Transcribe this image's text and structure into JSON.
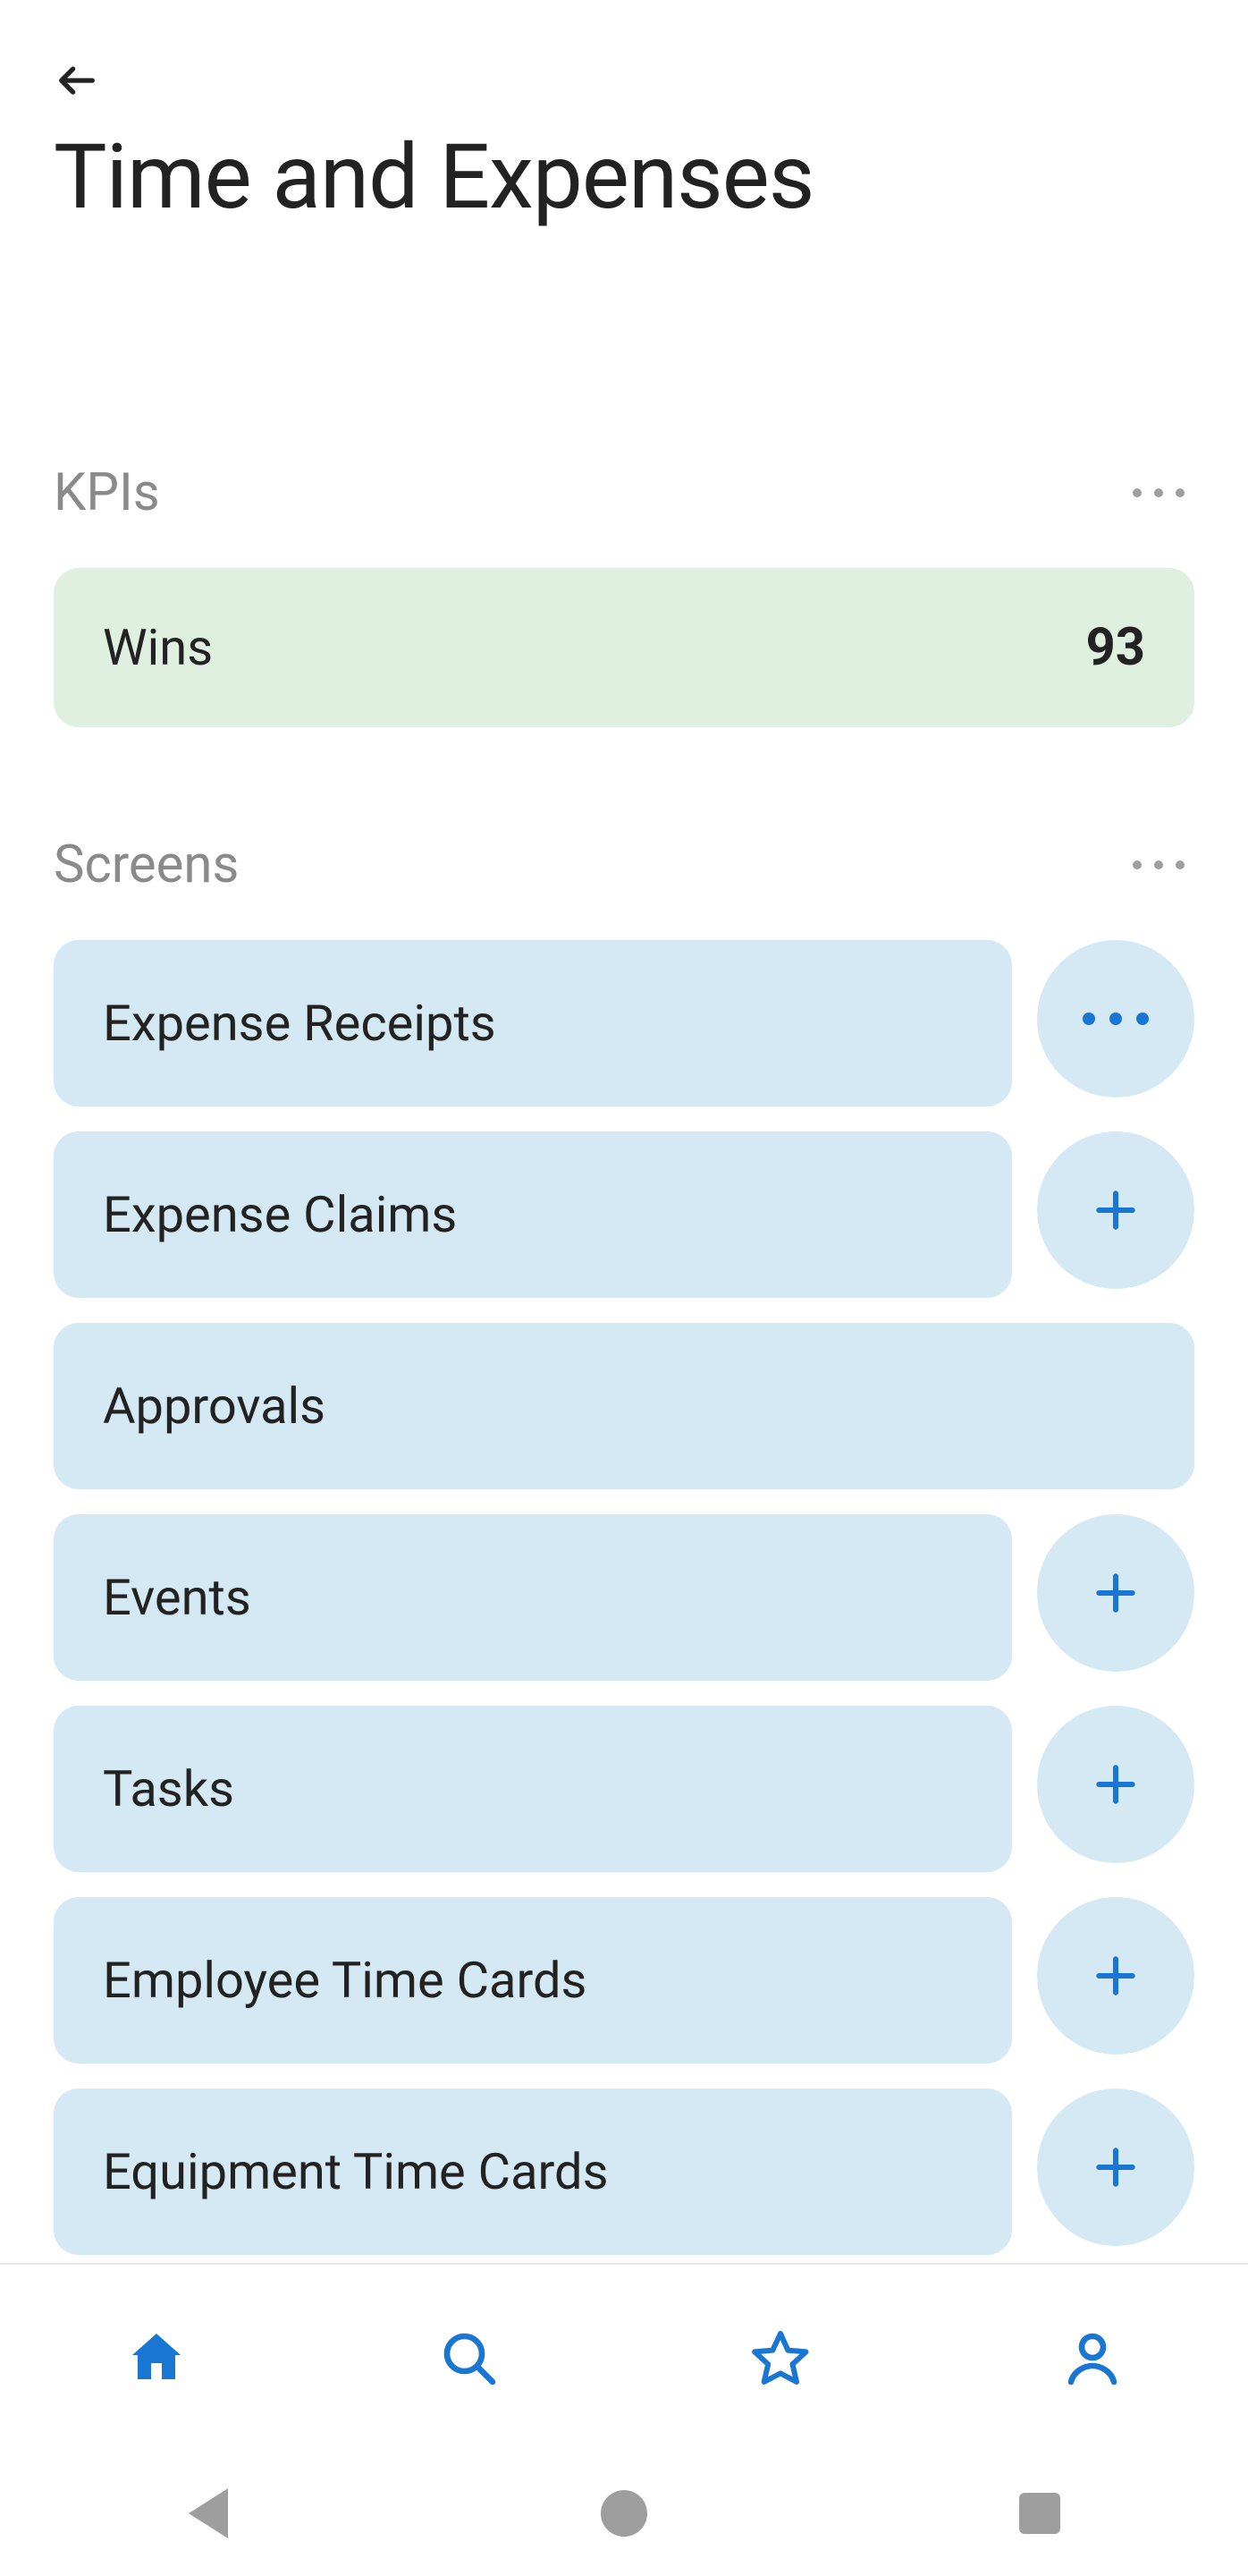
{
  "header": {
    "title": "Time and Expenses"
  },
  "kpis": {
    "section_label": "KPIs",
    "items": [
      {
        "label": "Wins",
        "value": "93"
      }
    ]
  },
  "screens": {
    "section_label": "Screens",
    "items": [
      {
        "label": "Expense Receipts",
        "action": "more"
      },
      {
        "label": "Expense Claims",
        "action": "add"
      },
      {
        "label": "Approvals",
        "action": "none"
      },
      {
        "label": "Events",
        "action": "add"
      },
      {
        "label": "Tasks",
        "action": "add"
      },
      {
        "label": "Employee Time Cards",
        "action": "add"
      },
      {
        "label": "Equipment Time Cards",
        "action": "add"
      }
    ]
  },
  "colors": {
    "accent": "#1976d2",
    "kpi_bg": "#dff0e1",
    "chip_bg": "#d5e9f5"
  }
}
